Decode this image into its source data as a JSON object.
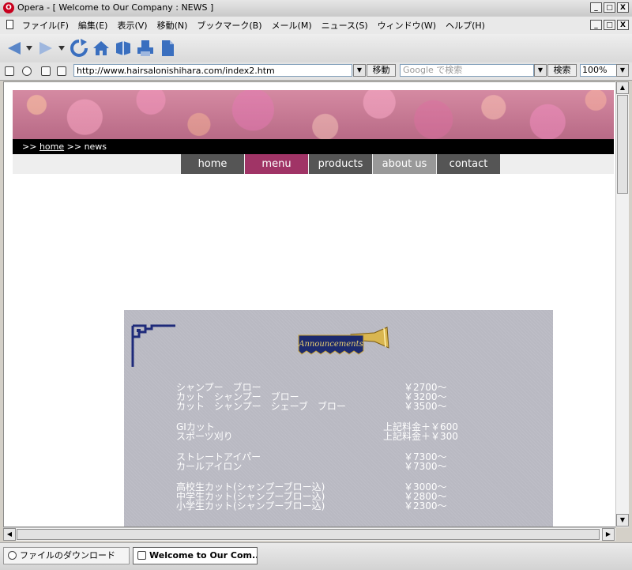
{
  "window": {
    "title": "Opera - [ Welcome to Our Company : NEWS ]",
    "app_icon_letter": "O",
    "buttons": {
      "minimize": "_",
      "maximize": "□",
      "close": "X"
    }
  },
  "menu": {
    "items": [
      "ファイル(F)",
      "編集(E)",
      "表示(V)",
      "移動(N)",
      "ブックマーク(B)",
      "メール(M)",
      "ニュース(S)",
      "ウィンドウ(W)",
      "ヘルプ(H)"
    ]
  },
  "address_bar": {
    "url": "http://www.hairsalonishihara.com/index2.htm",
    "go_label": "移動",
    "search_placeholder": "Google で検索",
    "search_button": "検索",
    "zoom": "100%"
  },
  "page": {
    "breadcrumb": {
      "prefix": ">>",
      "home": "home",
      "separator": ">>",
      "current": "news"
    },
    "nav": [
      {
        "label": "home",
        "color": "#555555"
      },
      {
        "label": "menu",
        "color": "#a03466"
      },
      {
        "label": "products",
        "color": "#555555"
      },
      {
        "label": "about us",
        "color": "#999999"
      },
      {
        "label": "contact",
        "color": "#555555"
      }
    ],
    "announcement_label": "Announcements",
    "price_groups": [
      [
        {
          "name": "シャンプー　ブロー",
          "price": "￥2700〜"
        },
        {
          "name": "カット　シャンプー　ブロー",
          "price": "￥3200〜"
        },
        {
          "name": "カット　シャンプー　シェーブ　ブロー",
          "price": "￥3500〜"
        }
      ],
      [
        {
          "name": "GIカット",
          "price": "上記料金＋￥600"
        },
        {
          "name": "スポーツ刈り",
          "price": "上記料金＋￥300"
        }
      ],
      [
        {
          "name": "ストレートアイパー",
          "price": "￥7300〜"
        },
        {
          "name": "カールアイロン",
          "price": "￥7300〜"
        }
      ],
      [
        {
          "name": "高校生カット(シャンプーブロー込)",
          "price": "￥3000〜"
        },
        {
          "name": "中学生カット(シャンプーブロー込)",
          "price": "￥2800〜"
        },
        {
          "name": "小学生カット(シャンプーブロー込)",
          "price": "￥2300〜"
        }
      ]
    ]
  },
  "status": {
    "tabs": [
      "ファイルのダウンロード",
      "Welcome to Our Com..."
    ]
  }
}
